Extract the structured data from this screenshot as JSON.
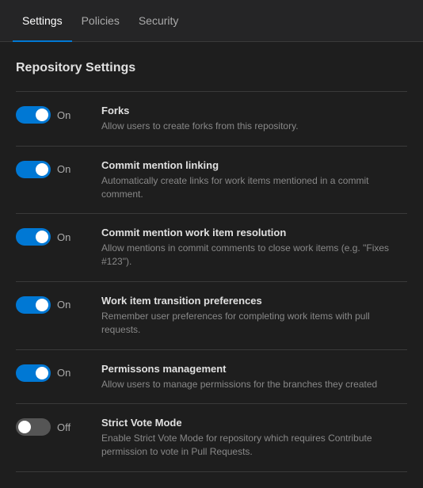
{
  "tabs": [
    {
      "id": "settings",
      "label": "Settings",
      "active": true
    },
    {
      "id": "policies",
      "label": "Policies",
      "active": false
    },
    {
      "id": "security",
      "label": "Security",
      "active": false
    }
  ],
  "section": {
    "title": "Repository Settings"
  },
  "settings": [
    {
      "id": "forks",
      "state": "on",
      "state_label": "On",
      "name": "Forks",
      "description": "Allow users to create forks from this repository."
    },
    {
      "id": "commit-mention-linking",
      "state": "on",
      "state_label": "On",
      "name": "Commit mention linking",
      "description": "Automatically create links for work items mentioned in a commit comment."
    },
    {
      "id": "commit-mention-work-item-resolution",
      "state": "on",
      "state_label": "On",
      "name": "Commit mention work item resolution",
      "description": "Allow mentions in commit comments to close work items (e.g. \"Fixes #123\")."
    },
    {
      "id": "work-item-transition-preferences",
      "state": "on",
      "state_label": "On",
      "name": "Work item transition preferences",
      "description": "Remember user preferences for completing work items with pull requests."
    },
    {
      "id": "permissions-management",
      "state": "on",
      "state_label": "On",
      "name": "Permissons management",
      "description": "Allow users to manage permissions for the branches they created"
    },
    {
      "id": "strict-vote-mode",
      "state": "off",
      "state_label": "Off",
      "name": "Strict Vote Mode",
      "description": "Enable Strict Vote Mode for repository which requires Contribute permission to vote in Pull Requests."
    }
  ]
}
